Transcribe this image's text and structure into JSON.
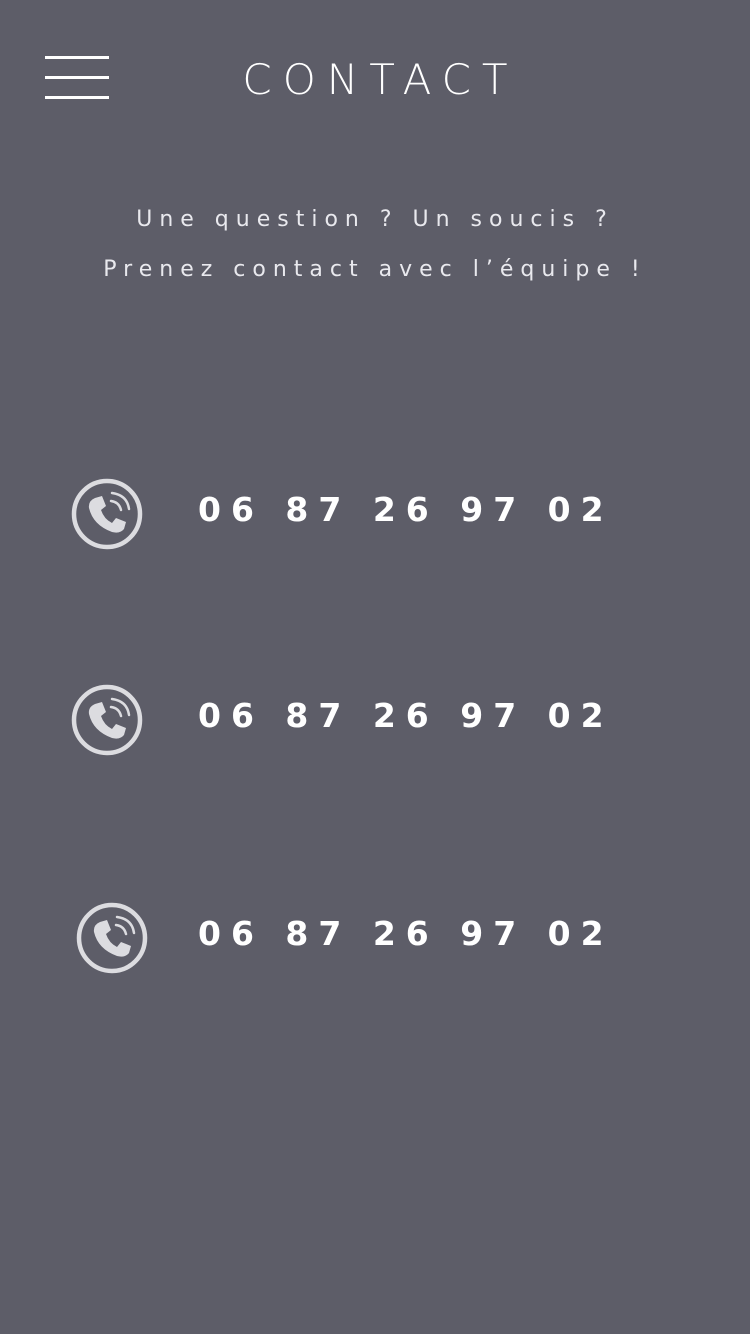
{
  "header": {
    "title": "CONTACT",
    "menu_icon": "hamburger-menu-icon"
  },
  "intro": {
    "line1": "Une question ? Un soucis  ?",
    "line2": "Prenez contact avec l’équipe !"
  },
  "contacts": [
    {
      "icon": "phone-call-icon",
      "number": "06 87 26 97 02"
    },
    {
      "icon": "phone-call-icon",
      "number": "06 87 26 97 02"
    },
    {
      "icon": "phone-call-icon",
      "number": "06 87 26 97 02"
    }
  ],
  "colors": {
    "background": "#5d5d68",
    "text": "#ffffff",
    "icon": "#dcdce0"
  }
}
